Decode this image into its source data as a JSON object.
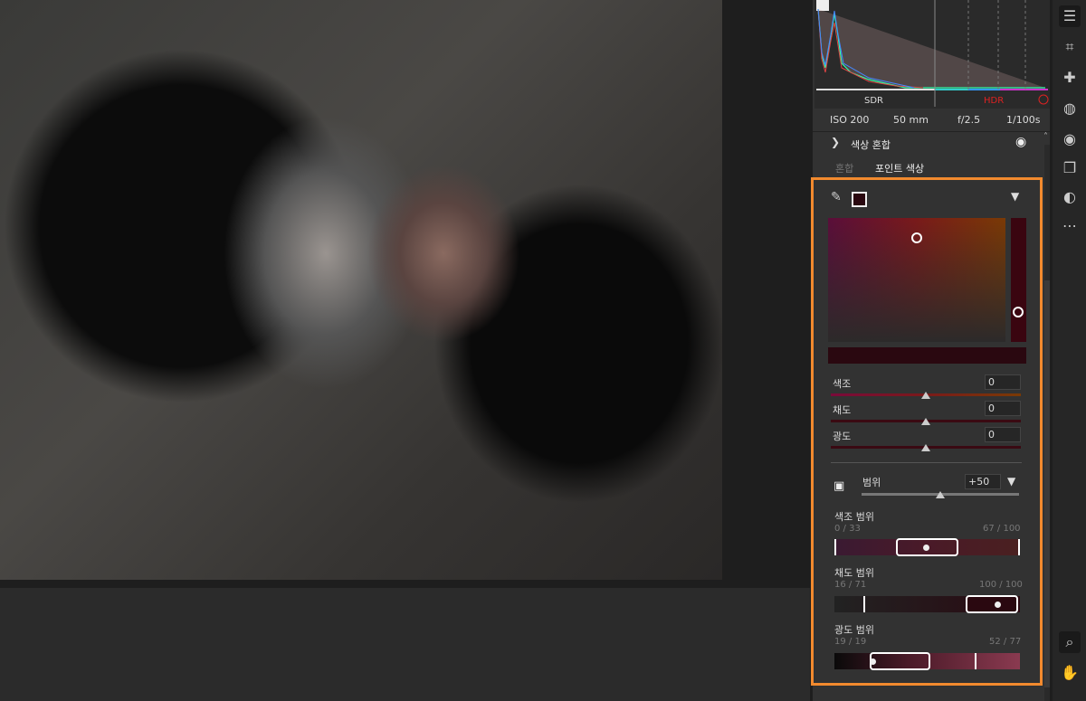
{
  "histogram": {
    "sdr_label": "SDR",
    "hdr_label": "HDR"
  },
  "exif": {
    "iso": "ISO 200",
    "focal": "50 mm",
    "aperture": "f/2.5",
    "shutter": "1/100s"
  },
  "section": {
    "title": "색상 혼합",
    "tabs": [
      {
        "label": "혼합"
      },
      {
        "label": "포인트 색상"
      }
    ]
  },
  "point_color": {
    "swatch_color": "#2a0810",
    "sliders": [
      {
        "label": "색조",
        "value": "0"
      },
      {
        "label": "채도",
        "value": "0"
      },
      {
        "label": "광도",
        "value": "0"
      }
    ],
    "range": {
      "label": "범위",
      "value": "+50"
    },
    "hue_range": {
      "label": "색조 범위",
      "left": "0 / 33",
      "right": "67 / 100"
    },
    "sat_range": {
      "label": "채도 범위",
      "left": "16 / 71",
      "right": "100 / 100"
    },
    "lum_range": {
      "label": "광도 범위",
      "left": "19 / 19",
      "right": "52 / 77"
    }
  },
  "colors": {
    "accent": "#f28a2e"
  }
}
